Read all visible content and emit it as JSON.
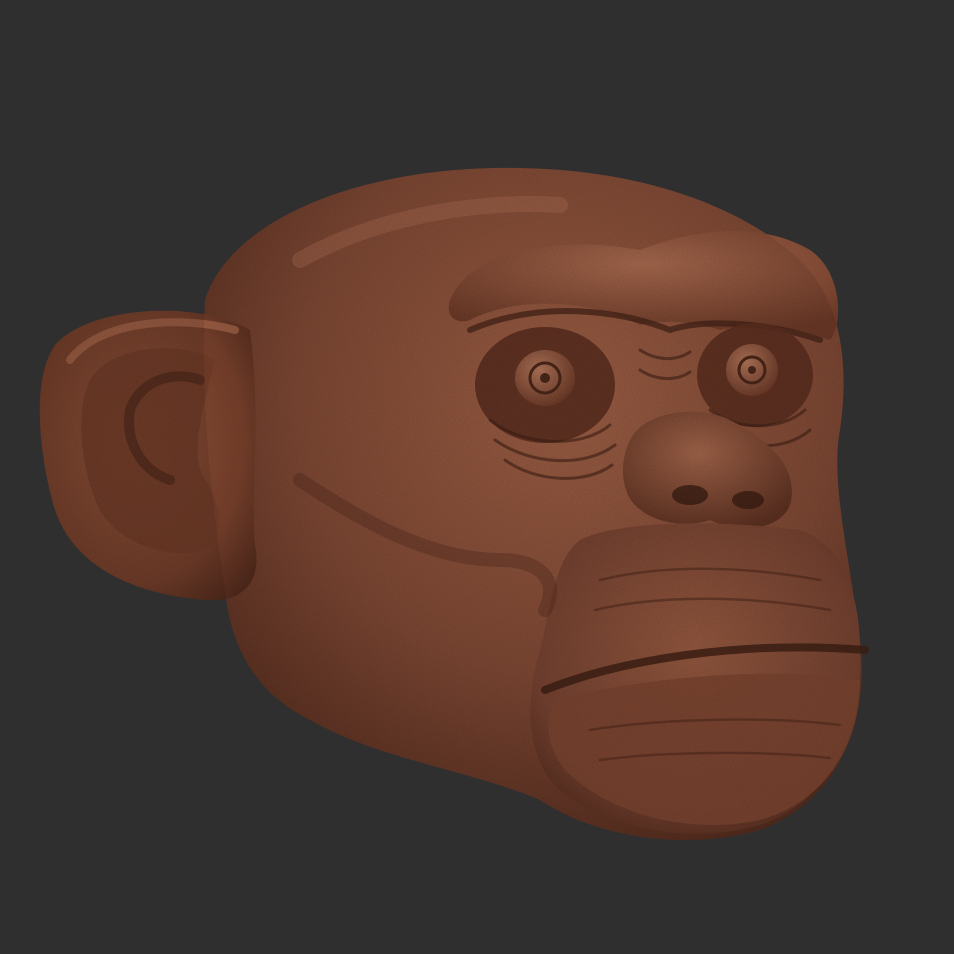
{
  "scene": {
    "subject": "chimpanzee-head-sculpt",
    "colors": {
      "background": "#2f2f2f",
      "clay_base": "#7a4632",
      "clay_light": "#9a5c42",
      "clay_highlight": "#b3735a",
      "clay_shadow": "#4a2619",
      "clay_deep": "#2e160e"
    }
  }
}
